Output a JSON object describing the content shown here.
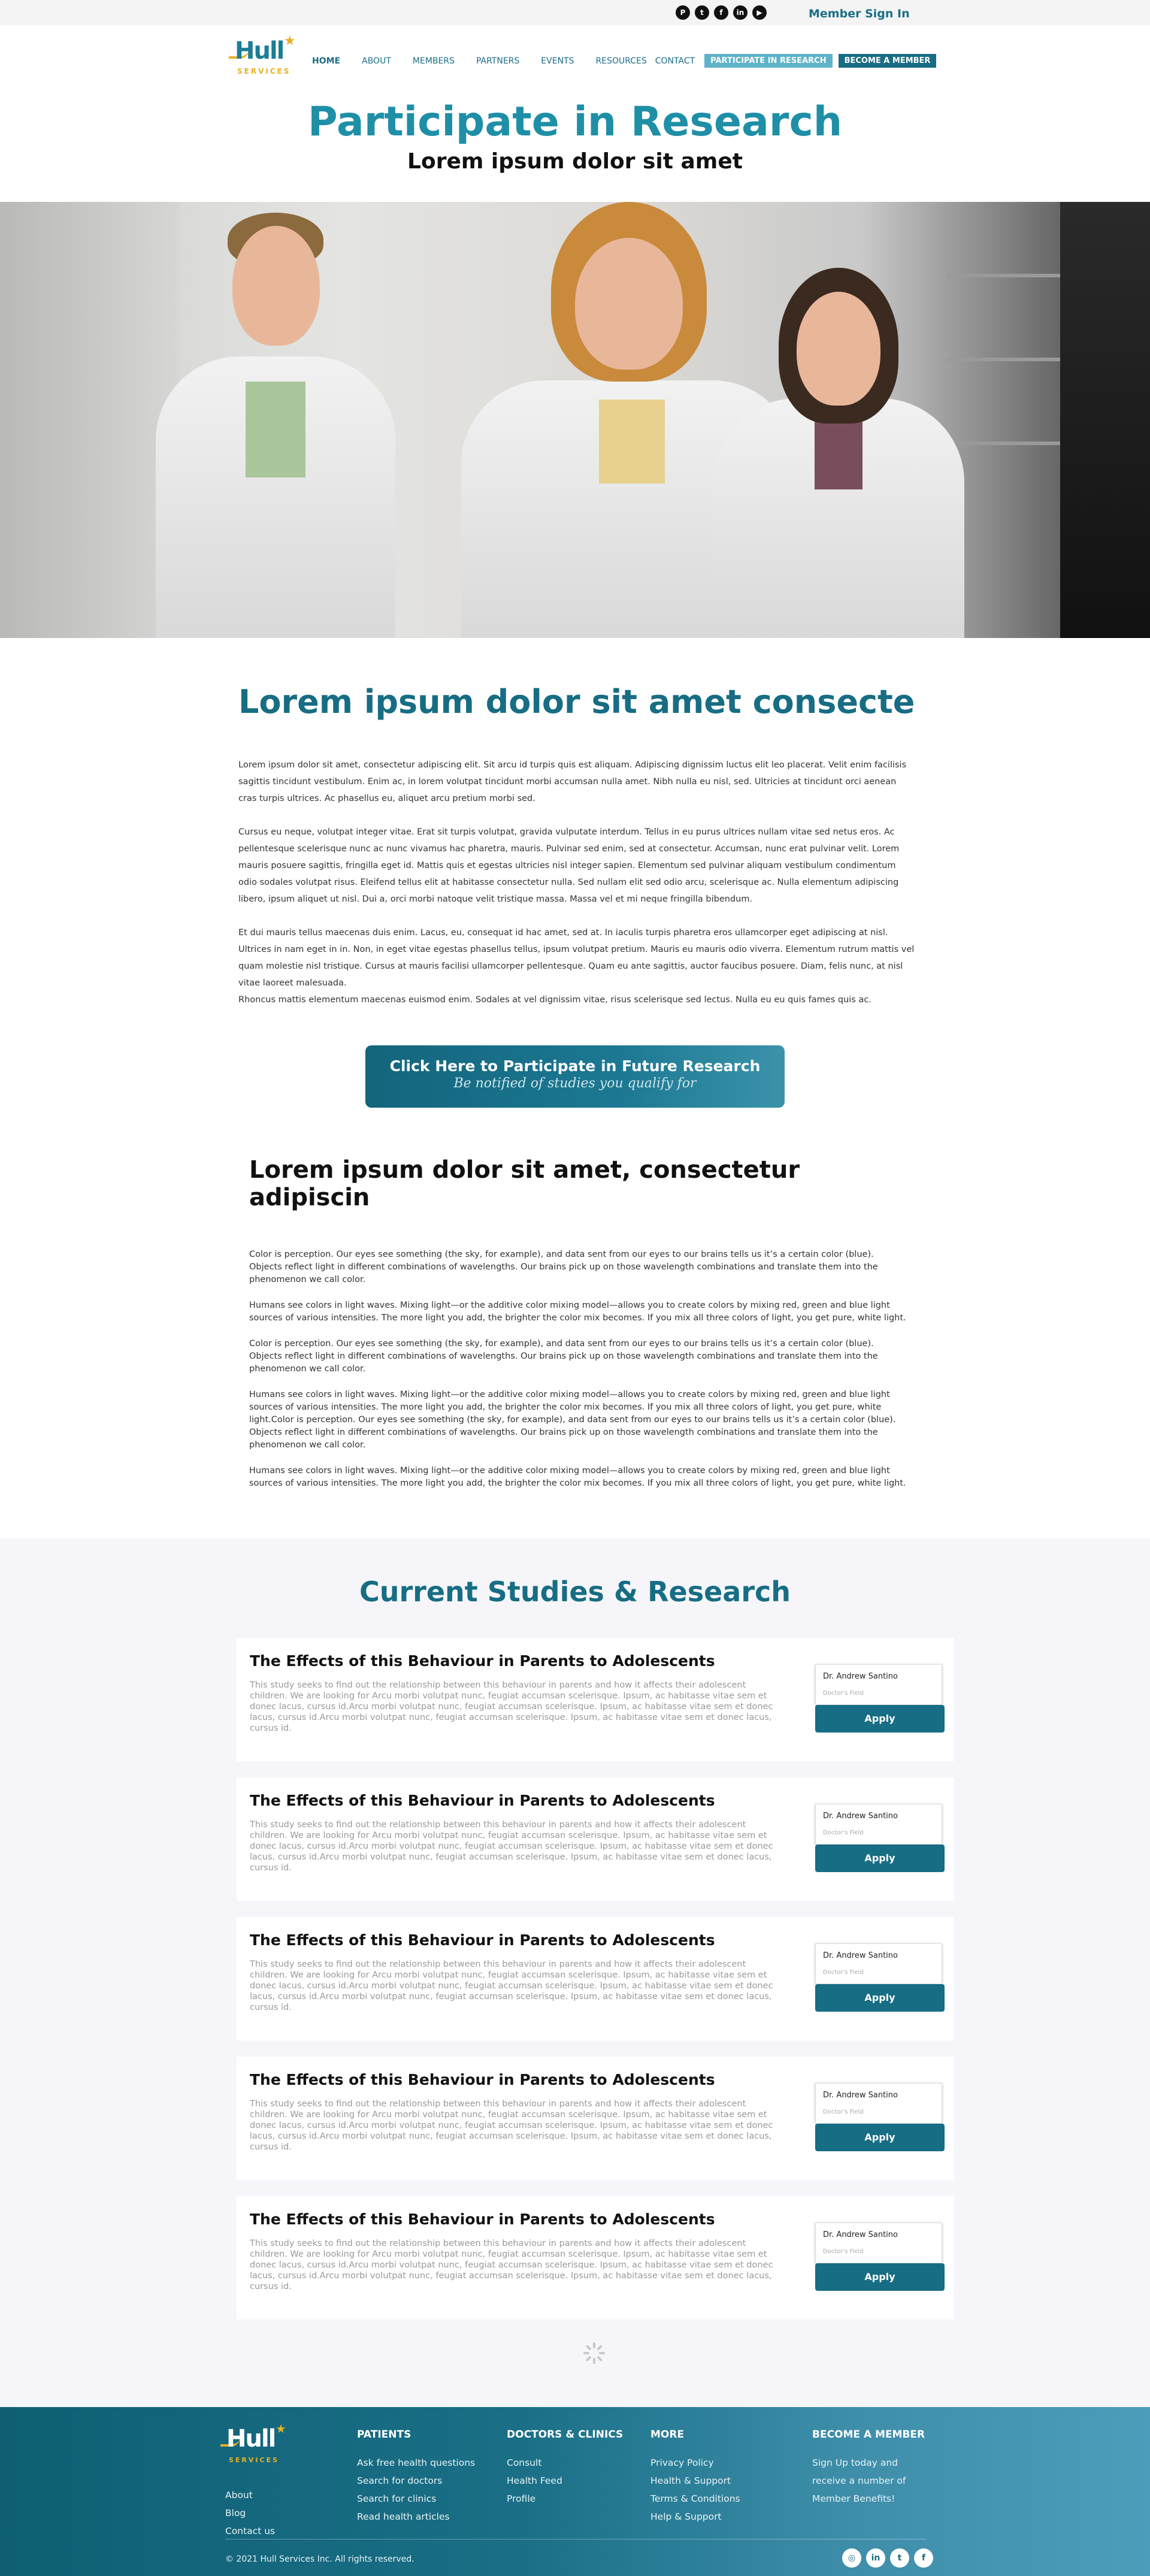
{
  "topbar": {
    "socials": [
      {
        "icon": "pinterest-icon",
        "glyph": "P"
      },
      {
        "icon": "twitter-icon",
        "glyph": "t"
      },
      {
        "icon": "facebook-icon",
        "glyph": "f"
      },
      {
        "icon": "linkedin-icon",
        "glyph": "in"
      },
      {
        "icon": "youtube-icon",
        "glyph": "▶"
      }
    ],
    "member_sign_in": "Member Sign In"
  },
  "header": {
    "logo_word": "Hull",
    "logo_sub": "SERVICES",
    "nav": [
      "HOME",
      "ABOUT",
      "MEMBERS",
      "PARTNERS",
      "EVENTS",
      "RESOURCES",
      "CONTACT"
    ],
    "cta_participate": "PARTICIPATE IN RESEARCH",
    "cta_member": "BECOME A MEMBER"
  },
  "hero": {
    "title": "Participate in Research",
    "subtitle": "Lorem ipsum dolor sit amet"
  },
  "intro": {
    "heading": "Lorem ipsum dolor sit amet consecte",
    "p1": "Lorem ipsum dolor sit amet, consectetur adipiscing elit. Sit arcu id turpis quis est aliquam. Adipiscing dignissim luctus elit leo placerat. Velit enim facilisis sagittis tincidunt vestibulum. Enim ac, in lorem volutpat tincidunt morbi accumsan nulla amet. Nibh nulla eu nisl, sed. Ultricies at tincidunt orci aenean cras turpis ultrices. Ac phasellus eu, aliquet arcu pretium morbi sed.",
    "p2": "Cursus eu neque, volutpat integer vitae. Erat sit turpis volutpat, gravida vulputate interdum. Tellus in eu purus ultrices nullam vitae sed netus eros. Ac pellentesque scelerisque nunc ac nunc vivamus hac pharetra, mauris. Pulvinar sed enim, sed at consectetur. Accumsan, nunc erat pulvinar velit. Lorem mauris posuere sagittis, fringilla eget id. Mattis quis et egestas ultricies nisl integer sapien. Elementum sed pulvinar aliquam vestibulum condimentum odio sodales volutpat risus. Eleifend tellus elit at habitasse consectetur nulla. Sed nullam elit sed odio arcu, scelerisque ac. Nulla elementum adipiscing libero, ipsum aliquet ut nisl. Dui a, orci morbi natoque velit tristique massa. Massa vel et mi neque fringilla bibendum.",
    "p3": "Et dui mauris tellus maecenas duis enim. Lacus, eu, consequat id hac amet, sed at. In iaculis turpis pharetra eros ullamcorper eget adipiscing at nisl. Ultrices in nam eget in in. Non, in eget vitae egestas phasellus tellus, ipsum volutpat pretium. Mauris eu mauris odio viverra. Elementum rutrum mattis vel quam molestie nisl tristique. Cursus at mauris facilisi ullamcorper pellentesque. Quam eu ante sagittis, auctor faucibus posuere. Diam, felis nunc, at nisl vitae laoreet malesuada.",
    "p4": "Rhoncus mattis elementum maecenas euismod enim. Sodales at vel dignissim vitae, risus scelerisque sed lectus. Nulla eu eu quis fames quis ac."
  },
  "cta_banner": {
    "title": "Click Here to Participate in Future Research",
    "subtitle": "Be notified of studies you qualify for"
  },
  "second": {
    "heading": "Lorem ipsum dolor sit amet, consectetur adipiscin",
    "p1": "Color is perception. Our eyes see something (the sky, for example), and data sent from our eyes to our brains tells us it’s a certain color (blue). Objects reflect light in different combinations of wavelengths. Our brains pick up on those wavelength combinations and translate them into the phenomenon we call color.",
    "p2": "Humans see colors in light waves. Mixing light—or the additive color mixing model—allows you to create colors by mixing red, green and blue light sources of various intensities. The more light you add, the brighter the color mix becomes. If you mix all three colors of light, you get pure, white light.",
    "p3": "Color is perception. Our eyes see something (the sky, for example), and data sent from our eyes to our brains tells us it’s a certain color (blue). Objects reflect light in different combinations of wavelengths. Our brains pick up on those wavelength combinations and translate them into the phenomenon we call color.",
    "p4": "Humans see colors in light waves. Mixing light—or the additive color mixing model—allows you to create colors by mixing red, green and blue light sources of various intensities. The more light you add, the brighter the color mix becomes. If you mix all three colors of light, you get pure, white light.Color is perception. Our eyes see something (the sky, for example), and data sent from our eyes to our brains tells us it’s a certain color (blue). Objects reflect light in different combinations of wavelengths. Our brains pick up on those wavelength combinations and translate them into the phenomenon we call color.",
    "p5": "Humans see colors in light waves. Mixing light—or the additive color mixing model—allows you to create colors by mixing red, green and blue light sources of various intensities. The more light you add, the brighter the color mix becomes. If you mix all three colors of light, you get pure, white light."
  },
  "studies": {
    "heading": "Current Studies & Research",
    "items": [
      {
        "title": "The Effects of this Behaviour in Parents to Adolescents",
        "desc": "This study seeks to find out the relationship between this behaviour in parents and how it affects their adolescent children. We are looking for Arcu morbi volutpat nunc, feugiat accumsan scelerisque. Ipsum, ac habitasse vitae sem et donec lacus, cursus id.Arcu morbi volutpat nunc, feugiat accumsan scelerisque. Ipsum, ac habitasse vitae sem et donec lacus, cursus id.Arcu morbi volutpat nunc, feugiat accumsan scelerisque. Ipsum, ac habitasse vitae sem et donec lacus, cursus id.",
        "doctor": "Dr. Andrew Santino",
        "field": "Doctor's Field",
        "apply": "Apply"
      },
      {
        "title": "The Effects of this Behaviour in Parents to Adolescents",
        "desc": "This study seeks to find out the relationship between this behaviour in parents and how it affects their adolescent children. We are looking for Arcu morbi volutpat nunc, feugiat accumsan scelerisque. Ipsum, ac habitasse vitae sem et donec lacus, cursus id.Arcu morbi volutpat nunc, feugiat accumsan scelerisque. Ipsum, ac habitasse vitae sem et donec lacus, cursus id.Arcu morbi volutpat nunc, feugiat accumsan scelerisque. Ipsum, ac habitasse vitae sem et donec lacus, cursus id.",
        "doctor": "Dr. Andrew Santino",
        "field": "Doctor's Field",
        "apply": "Apply"
      },
      {
        "title": "The Effects of this Behaviour in Parents to Adolescents",
        "desc": "This study seeks to find out the relationship between this behaviour in parents and how it affects their adolescent children. We are looking for Arcu morbi volutpat nunc, feugiat accumsan scelerisque. Ipsum, ac habitasse vitae sem et donec lacus, cursus id.Arcu morbi volutpat nunc, feugiat accumsan scelerisque. Ipsum, ac habitasse vitae sem et donec lacus, cursus id.Arcu morbi volutpat nunc, feugiat accumsan scelerisque. Ipsum, ac habitasse vitae sem et donec lacus, cursus id.",
        "doctor": "Dr. Andrew Santino",
        "field": "Doctor's Field",
        "apply": "Apply"
      },
      {
        "title": "The Effects of this Behaviour in Parents to Adolescents",
        "desc": "This study seeks to find out the relationship between this behaviour in parents and how it affects their adolescent children. We are looking for Arcu morbi volutpat nunc, feugiat accumsan scelerisque. Ipsum, ac habitasse vitae sem et donec lacus, cursus id.Arcu morbi volutpat nunc, feugiat accumsan scelerisque. Ipsum, ac habitasse vitae sem et donec lacus, cursus id.Arcu morbi volutpat nunc, feugiat accumsan scelerisque. Ipsum, ac habitasse vitae sem et donec lacus, cursus id.",
        "doctor": "Dr. Andrew Santino",
        "field": "Doctor's Field",
        "apply": "Apply"
      },
      {
        "title": "The Effects of this Behaviour in Parents to Adolescents",
        "desc": "This study seeks to find out the relationship between this behaviour in parents and how it affects their adolescent children. We are looking for Arcu morbi volutpat nunc, feugiat accumsan scelerisque. Ipsum, ac habitasse vitae sem et donec lacus, cursus id.Arcu morbi volutpat nunc, feugiat accumsan scelerisque. Ipsum, ac habitasse vitae sem et donec lacus, cursus id.Arcu morbi volutpat nunc, feugiat accumsan scelerisque. Ipsum, ac habitasse vitae sem et donec lacus, cursus id.",
        "doctor": "Dr. Andrew Santino",
        "field": "Doctor's Field",
        "apply": "Apply"
      }
    ]
  },
  "footer": {
    "about_links": [
      "About",
      "Blog",
      "Contact us"
    ],
    "patients": {
      "heading": "PATIENTS",
      "links": [
        "Ask free health questions",
        "Search for doctors",
        "Search for clinics",
        "Read health articles"
      ]
    },
    "doctors": {
      "heading": "DOCTORS & CLINICS",
      "links": [
        "Consult",
        "Health Feed",
        "Profile"
      ]
    },
    "more": {
      "heading": "MORE",
      "links": [
        "Privacy Policy",
        "Health & Support",
        "Terms & Conditions",
        "Help & Support"
      ]
    },
    "member": {
      "heading": "BECOME A MEMBER",
      "text": "Sign Up today and receive a number of Member Benefits!"
    },
    "copyright": "© 2021 Hull Services Inc. All rights reserved.",
    "socials": [
      {
        "icon": "instagram-icon",
        "glyph": "◎"
      },
      {
        "icon": "linkedin-icon",
        "glyph": "in"
      },
      {
        "icon": "twitter-icon",
        "glyph": "t"
      },
      {
        "icon": "facebook-icon",
        "glyph": "f"
      }
    ]
  },
  "colors": {
    "brand_teal": "#176d83",
    "hero_teal": "#1e8fa6",
    "accent_gold": "#e9b022",
    "light_teal": "#5fb3c8"
  }
}
